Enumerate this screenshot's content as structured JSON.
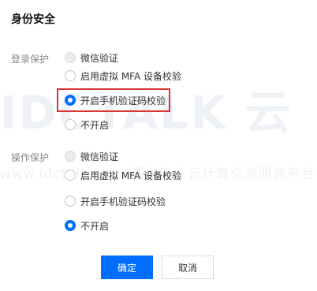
{
  "title": "身份安全",
  "watermark": {
    "text": "IDCTALK 云",
    "url": "www.idctalk.com-国内专业云计算交流服务平台"
  },
  "login_protection": {
    "label": "登录保护",
    "options": [
      "微信验证",
      "启用虚拟 MFA 设备校验",
      "开启手机验证码校验",
      "不开启"
    ],
    "selected": "开启手机验证码校验"
  },
  "operation_protection": {
    "label": "操作保护",
    "options": [
      "微信验证",
      "启用虚拟 MFA 设备校验",
      "开启手机验证码校验",
      "不开启"
    ],
    "selected": "不开启"
  },
  "buttons": {
    "confirm": "确定",
    "cancel": "取消"
  },
  "colors": {
    "primary": "#006eff",
    "highlight_border": "#d63636",
    "watermark": "#eef2f6"
  }
}
